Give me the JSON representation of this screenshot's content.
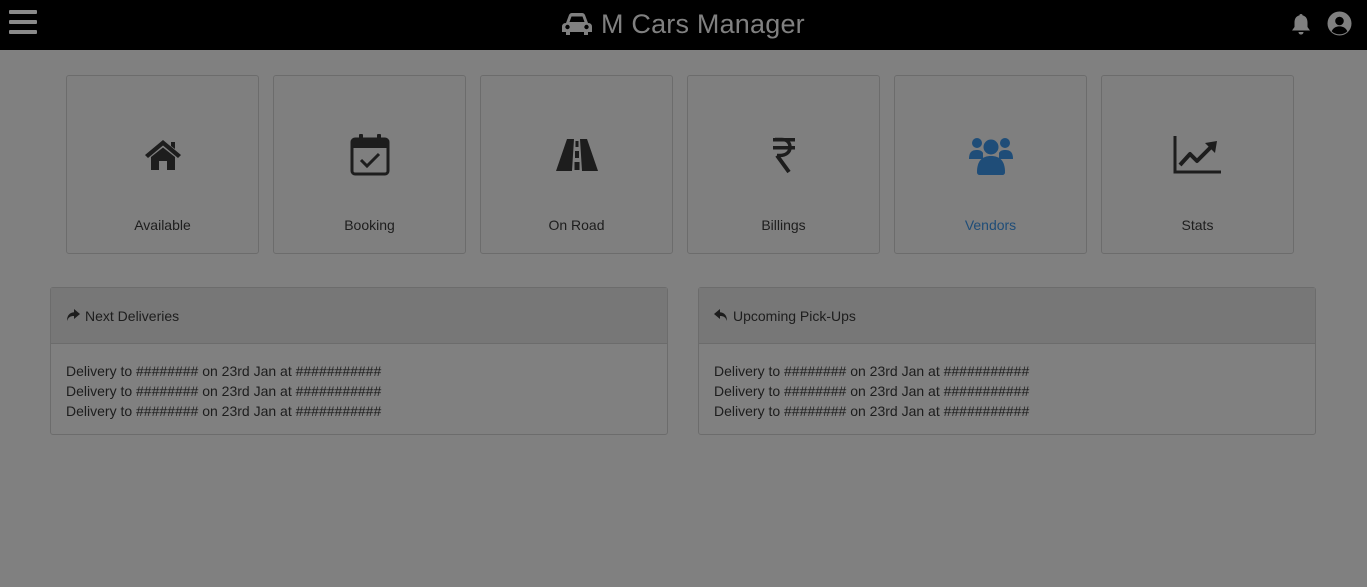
{
  "header": {
    "title": "M Cars Manager",
    "brand_icon": "car-icon",
    "menu_icon": "hamburger-menu-icon",
    "notifications_icon": "bell-icon",
    "profile_icon": "user-circle-icon"
  },
  "tiles": [
    {
      "label": "Available",
      "icon": "home-icon"
    },
    {
      "label": "Booking",
      "icon": "calendar-check-icon"
    },
    {
      "label": "On Road",
      "icon": "road-icon"
    },
    {
      "label": "Billings",
      "icon": "rupee-icon"
    },
    {
      "label": "Vendors",
      "icon": "users-icon",
      "active": true
    },
    {
      "label": "Stats",
      "icon": "line-chart-icon"
    }
  ],
  "panels": {
    "deliveries": {
      "title": "Next Deliveries",
      "icon": "share-arrow-icon",
      "rows": [
        "Delivery to ######## on 23rd Jan at ###########",
        "Delivery to ######## on 23rd Jan at ###########",
        "Delivery to ######## on 23rd Jan at ###########"
      ]
    },
    "pickups": {
      "title": "Upcoming Pick-Ups",
      "icon": "reply-arrow-icon",
      "rows": [
        "Delivery to ######## on 23rd Jan at ###########",
        "Delivery to ######## on 23rd Jan at ###########",
        "Delivery to ######## on 23rd Jan at ###########"
      ]
    }
  },
  "colors": {
    "topbar": "#000000",
    "overlay_background": "#808080",
    "active_accent": "#1f4d78"
  }
}
